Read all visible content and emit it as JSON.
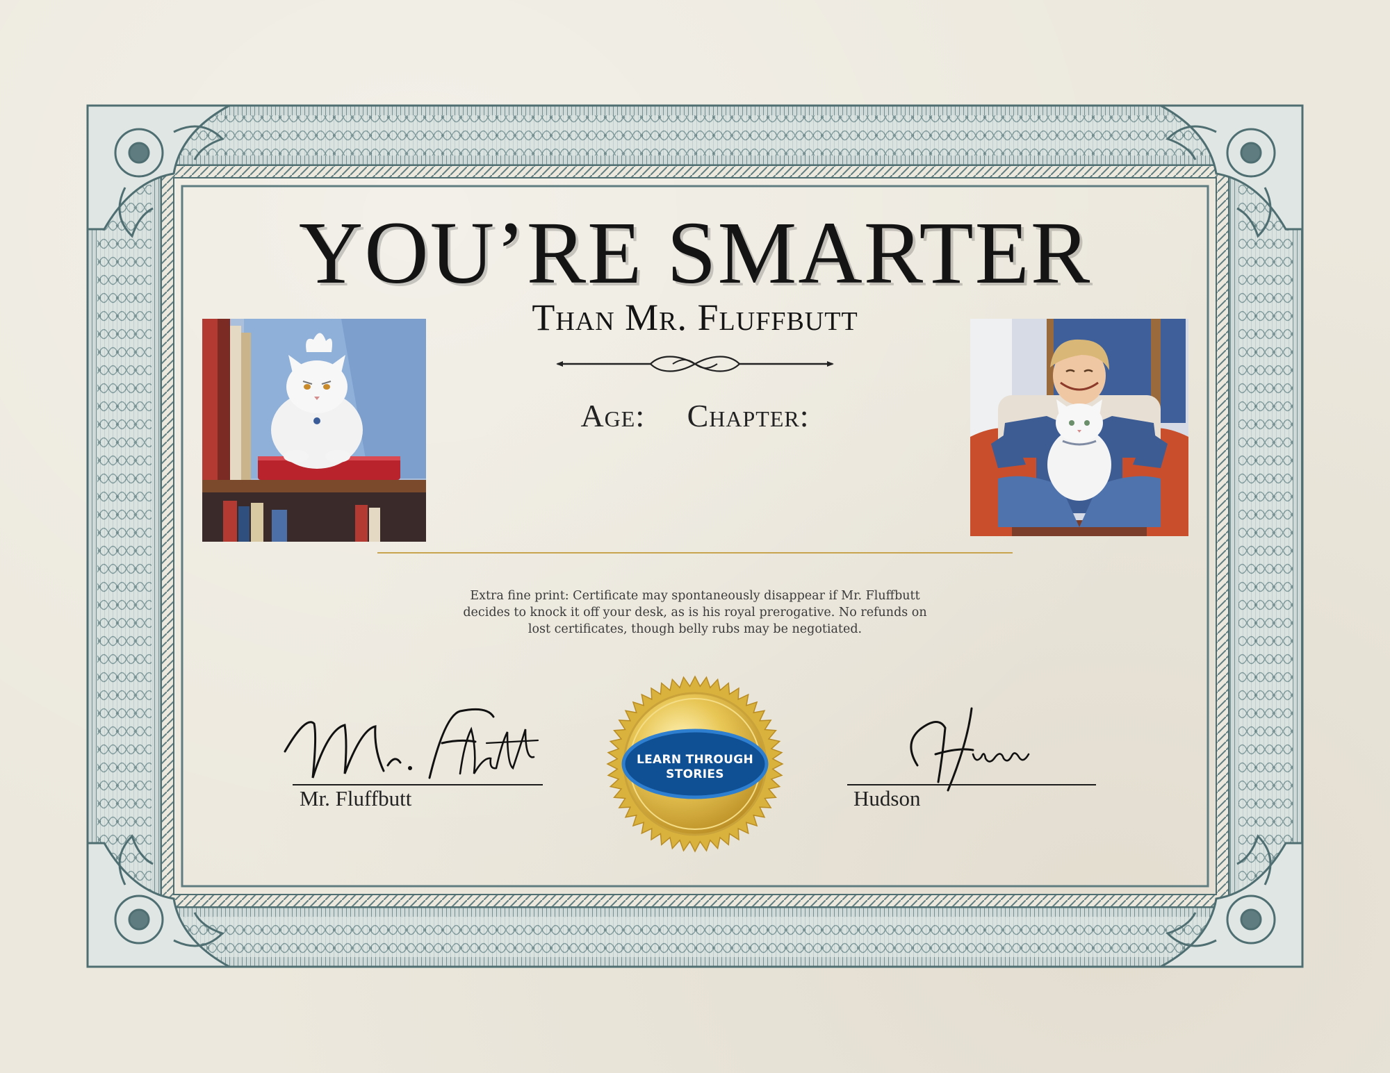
{
  "certificate": {
    "title": "YOU’RE SMARTER",
    "subtitle": "Than Mr. Fluffbutt",
    "fields": {
      "age_label": "Age:",
      "chapter_label": "Chapter:"
    },
    "fine_print": "Extra fine print: Certificate may spontaneously disappear if Mr. Fluffbutt decides to knock it off your desk, as is his royal prerogative. No refunds on lost certificates, though belly rubs may be negotiated.",
    "left_signatory": {
      "signature": "Mr. Fluffbutt",
      "name": "Mr. Fluffbutt"
    },
    "right_signatory": {
      "signature": "Hudson",
      "name": "Hudson"
    },
    "seal_text": "LEARN THROUGH STORIES"
  },
  "images": {
    "left": "grumpy-white-cat-on-bookshelf",
    "right": "smiling-boy-with-white-cat-in-armchair"
  },
  "colors": {
    "frame": "#5f7d80",
    "frame_light": "#a9bcbd",
    "paper": "#ece8dd",
    "gold_line": "#c8a44e",
    "seal_gold": "#e2bf4a",
    "seal_badge": "#0f4f93",
    "text": "#141414"
  }
}
